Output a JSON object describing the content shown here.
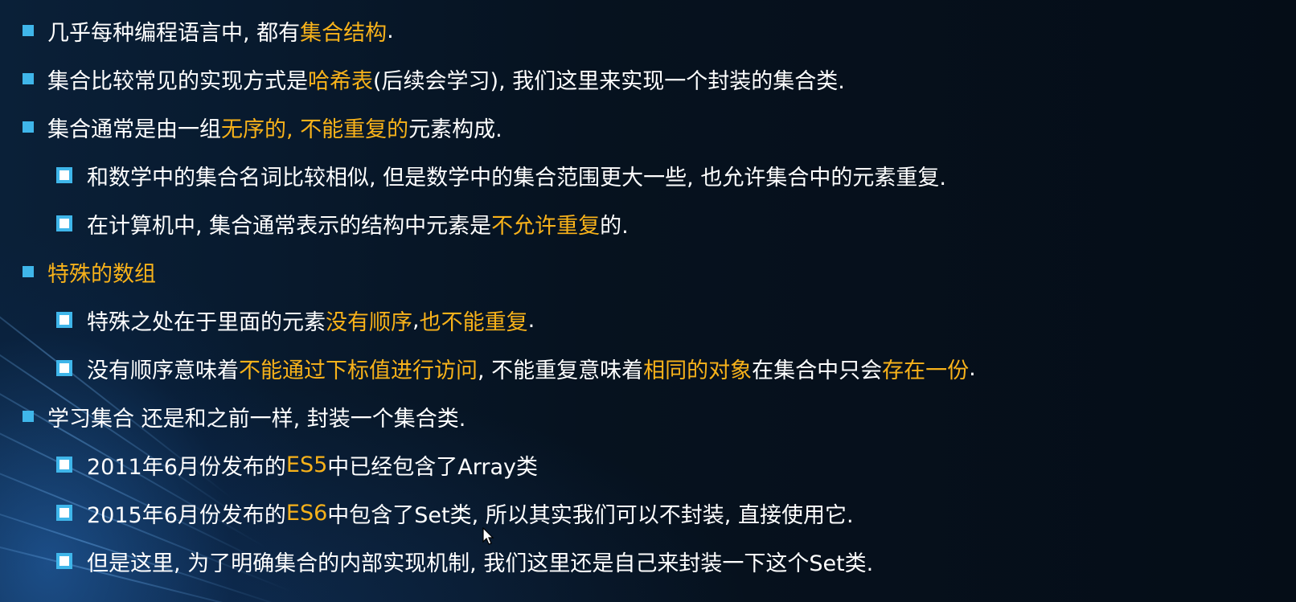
{
  "colors": {
    "bullet": "#3fb6ea",
    "highlight": "#f8b21a",
    "text": "#ffffff",
    "background": "#06101c"
  },
  "lines": [
    {
      "level": 1,
      "segments": [
        {
          "text": "几乎每种编程语言中, 都有",
          "hl": false
        },
        {
          "text": "集合结构",
          "hl": true
        },
        {
          "text": ".",
          "hl": false
        }
      ]
    },
    {
      "level": 1,
      "segments": [
        {
          "text": "集合比较常见的实现方式是 ",
          "hl": false
        },
        {
          "text": "哈希表",
          "hl": true
        },
        {
          "text": "(后续会学习), 我们这里来实现一个封装的集合类.",
          "hl": false
        }
      ]
    },
    {
      "level": 1,
      "segments": [
        {
          "text": "集合通常是由一组",
          "hl": false
        },
        {
          "text": "无序的, 不能重复的",
          "hl": true
        },
        {
          "text": "元素构成.",
          "hl": false
        }
      ]
    },
    {
      "level": 2,
      "segments": [
        {
          "text": "和数学中的集合名词比较相似, 但是数学中的集合范围更大一些, 也允许集合中的元素重复.",
          "hl": false
        }
      ]
    },
    {
      "level": 2,
      "segments": [
        {
          "text": "在计算机中, 集合通常表示的结构中元素是",
          "hl": false
        },
        {
          "text": "不允许重复",
          "hl": true
        },
        {
          "text": "的.",
          "hl": false
        }
      ]
    },
    {
      "level": 1,
      "segments": [
        {
          "text": "特殊的数组",
          "hl": true
        }
      ]
    },
    {
      "level": 2,
      "segments": [
        {
          "text": "特殊之处在于里面的元素",
          "hl": false
        },
        {
          "text": "没有顺序",
          "hl": true
        },
        {
          "text": ", ",
          "hl": false
        },
        {
          "text": "也不能重复",
          "hl": true
        },
        {
          "text": ".",
          "hl": false
        }
      ]
    },
    {
      "level": 2,
      "segments": [
        {
          "text": "没有顺序意味着",
          "hl": false
        },
        {
          "text": "不能通过下标值进行访问",
          "hl": true
        },
        {
          "text": ", 不能重复意味着",
          "hl": false
        },
        {
          "text": "相同的对象",
          "hl": true
        },
        {
          "text": "在集合中只会",
          "hl": false
        },
        {
          "text": "存在一份",
          "hl": true
        },
        {
          "text": ".",
          "hl": false
        }
      ]
    },
    {
      "level": 1,
      "segments": [
        {
          "text": "学习集合 还是和之前一样, 封装一个集合类.",
          "hl": false
        }
      ]
    },
    {
      "level": 2,
      "segments": [
        {
          "text": "2011年6月份发布的 ",
          "hl": false
        },
        {
          "text": "ES5",
          "hl": true
        },
        {
          "text": " 中已经包含了Array类",
          "hl": false
        }
      ]
    },
    {
      "level": 2,
      "segments": [
        {
          "text": "2015年6月份发布的 ",
          "hl": false
        },
        {
          "text": "ES6",
          "hl": true
        },
        {
          "text": " 中包含了Set类, 所以其实我们可以不封装, 直接使用它.",
          "hl": false
        }
      ]
    },
    {
      "level": 2,
      "segments": [
        {
          "text": "但是这里, 为了明确集合的内部实现机制, 我们这里还是自己来封装一下这个Set类.",
          "hl": false
        }
      ]
    }
  ]
}
